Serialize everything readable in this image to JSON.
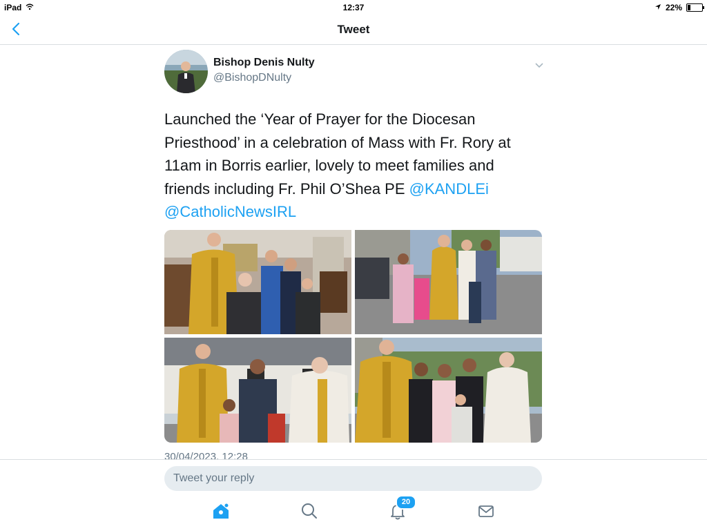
{
  "status_bar": {
    "device": "iPad",
    "time": "12:37",
    "battery": "22%",
    "battery_level": 0.22
  },
  "nav": {
    "title": "Tweet"
  },
  "tweet": {
    "author_name": "Bishop Denis Nulty",
    "author_handle": "@BishopDNulty",
    "text_plain": "Launched the ‘Year of Prayer for the Diocesan Priesthood’ in a celebration of Mass with Fr. Rory at 11am in Borris earlier, lovely to meet families and friends including Fr. Phil O’Shea PE ",
    "mention_1": "@KANDLEi",
    "mention_2": "@CatholicNewsIRL",
    "timestamp": "30/04/2023, 12:28"
  },
  "reply": {
    "placeholder": "Tweet your reply"
  },
  "tabbar": {
    "notifications_count": "20"
  },
  "colors": {
    "accent": "#1da1f2",
    "secondary_text": "#657786",
    "divider": "#d9dde0",
    "reply_bg": "#e6ecf0"
  },
  "icons": [
    "wifi-icon",
    "location-icon",
    "battery-icon",
    "back-chevron-icon",
    "chevron-down-icon",
    "home-icon",
    "search-icon",
    "notifications-icon",
    "messages-icon"
  ]
}
